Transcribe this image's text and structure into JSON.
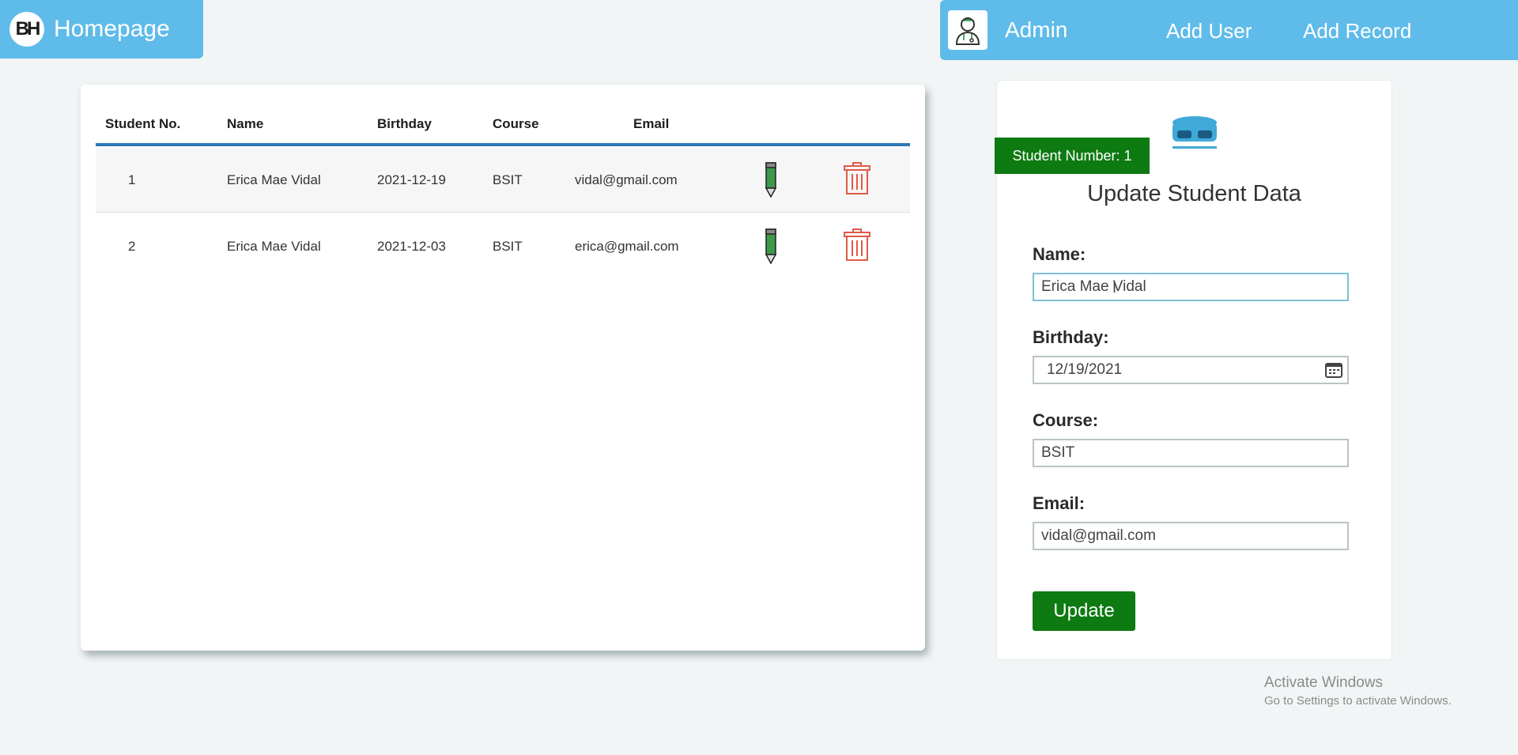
{
  "header": {
    "logo_text": "BH",
    "title": "Homepage",
    "admin_label": "Admin",
    "nav": {
      "add_user": "Add User",
      "add_record": "Add Record"
    }
  },
  "table": {
    "columns": [
      "Student No.",
      "Name",
      "Birthday",
      "Course",
      "Email"
    ],
    "rows": [
      {
        "no": "1",
        "name": "Erica Mae Vidal",
        "birthday": "2021-12-19",
        "course": "BSIT",
        "email": "vidal@gmail.com"
      },
      {
        "no": "2",
        "name": "Erica Mae Vidal",
        "birthday": "2021-12-03",
        "course": "BSIT",
        "email": "erica@gmail.com"
      }
    ]
  },
  "form": {
    "badge": "Student Number: 1",
    "title": "Update Student Data",
    "name_label": "Name:",
    "name_value": "Erica Mae Vidal",
    "birthday_label": "Birthday:",
    "birthday_value": "12/19/2021",
    "course_label": "Course:",
    "course_value": "BSIT",
    "email_label": "Email:",
    "email_value": "vidal@gmail.com",
    "update_button": "Update"
  },
  "watermark": {
    "line1": "Activate Windows",
    "line2": "Go to Settings to activate Windows."
  },
  "colors": {
    "header_blue": "#5fbbe9",
    "table_rule": "#2c78b8",
    "accent_green": "#0e7a12",
    "delete_red": "#e05a4a"
  },
  "icons": {
    "edit": "pencil-icon",
    "delete": "trash-icon",
    "admin": "doctor-avatar-icon",
    "calendar": "calendar-icon"
  }
}
